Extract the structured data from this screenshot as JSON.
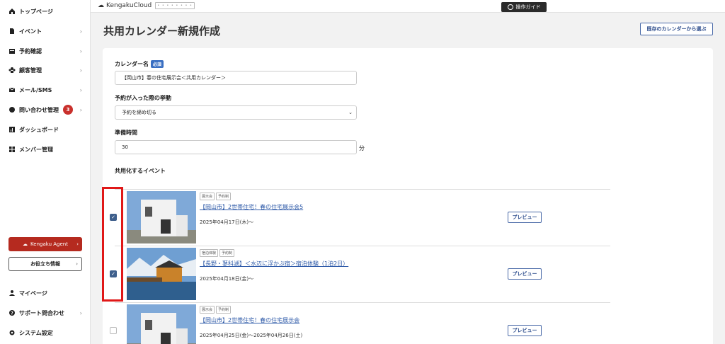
{
  "sidebar": {
    "items": [
      {
        "label": "トップページ",
        "icon": "home-icon",
        "chevron": false
      },
      {
        "label": "イベント",
        "icon": "document-icon",
        "chevron": true
      },
      {
        "label": "予約確認",
        "icon": "calendar-icon",
        "chevron": true
      },
      {
        "label": "顧客管理",
        "icon": "users-icon",
        "chevron": true
      },
      {
        "label": "メール/SMS",
        "icon": "mail-icon",
        "chevron": true
      },
      {
        "label": "問い合わせ管理",
        "icon": "chat-icon",
        "chevron": true,
        "badge": "3"
      },
      {
        "label": "ダッシュボード",
        "icon": "chart-icon",
        "chevron": false
      },
      {
        "label": "メンバー管理",
        "icon": "grid-icon",
        "chevron": false
      }
    ],
    "agent_button": "Kengaku Agent",
    "info_button": "お役立ち情報",
    "bottom_items": [
      {
        "label": "マイページ",
        "icon": "user-icon",
        "chevron": false
      },
      {
        "label": "サポート問合わせ",
        "icon": "help-icon",
        "chevron": true
      },
      {
        "label": "システム設定",
        "icon": "gear-icon",
        "chevron": false
      }
    ]
  },
  "header": {
    "logo_text": "KengakuCloud",
    "logo_tag": "• • • • • • • •",
    "guide_button": "操作ガイド"
  },
  "page": {
    "title": "共用カレンダー新規作成",
    "existing_button": "既存のカレンダーから選ぶ"
  },
  "form": {
    "calendar_name_label": "カレンダー名",
    "required_badge": "必須",
    "calendar_name_value": "【岡山市】春の住宅展示会＜共用カレンダー＞",
    "behavior_label": "予約が入った際の挙動",
    "behavior_value": "予約を締め切る",
    "prep_label": "準備時間",
    "prep_value": "30",
    "prep_unit": "分",
    "events_label": "共用化するイベント"
  },
  "events": [
    {
      "tags": [
        "展示会",
        "予約制"
      ],
      "title": "【岡山市】2世帯住宅！春の住宅展示会5",
      "date": "2025年04月17日(木)〜",
      "checked": true,
      "preview": "プレビュー"
    },
    {
      "tags": [
        "宿泊体験",
        "予約制"
      ],
      "title": "【長野・蓼科湖】＜水辺に浮かぶ宿＞宿泊体験（1泊2日）",
      "date": "2025年04月18日(金)〜",
      "checked": true,
      "preview": "プレビュー"
    },
    {
      "tags": [
        "展示会",
        "予約制"
      ],
      "title": "【岡山市】2世帯住宅！春の住宅展示会",
      "date": "2025年04月25日(金)〜2025年04月26日(土)",
      "checked": false,
      "preview": "プレビュー"
    }
  ],
  "colors": {
    "accent": "#2e5aa8",
    "brand_red": "#b52a1f",
    "highlight": "#e01818"
  }
}
